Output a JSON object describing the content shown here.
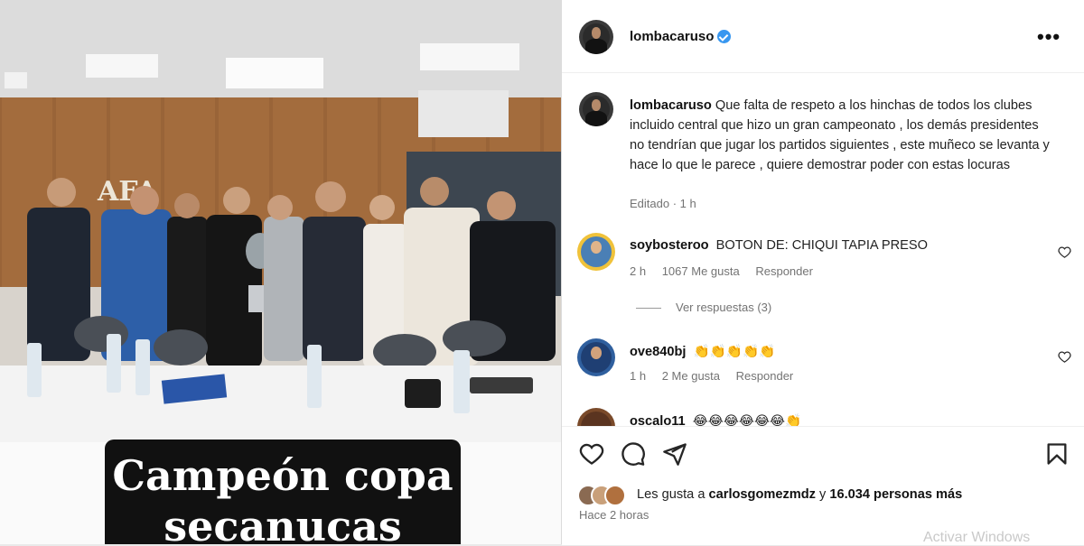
{
  "post": {
    "username": "lombacaruso",
    "caption": "Que falta de respeto a los hinchas de todos los clubes incluido central que hizo un gran campeonato , los demás presidentes no tendrían que jugar los partidos siguientes , este muñeco se levanta y hace lo que le parece , quiere demostrar poder con estas locuras",
    "caption_meta": "Editado · 1 h"
  },
  "image_caption": {
    "line1": "Campeón copa",
    "line2": "secanucas"
  },
  "comments": [
    {
      "username": "soybosteroo",
      "text": "BOTON DE: CHIQUI TAPIA PRESO",
      "time": "2 h",
      "likes": "1067 Me gusta",
      "reply": "Responder",
      "view_replies": "Ver respuestas (3)"
    },
    {
      "username": "ove840bj",
      "text": "👏👏👏👏👏",
      "time": "1 h",
      "likes": "2 Me gusta",
      "reply": "Responder"
    },
    {
      "username": "oscalo11",
      "text": "😂😂😂😂😂😂👏"
    }
  ],
  "likes": {
    "prefix": "Les gusta a",
    "user": "carlosgomezmdz",
    "middle": "y",
    "count": "16.034 personas más"
  },
  "posted_ago": "Hace 2 horas",
  "more_label": "•••",
  "watermark": "Activar Windows",
  "icons": [
    "verified-badge-icon",
    "more-options-icon",
    "heart-icon",
    "comment-icon",
    "share-icon",
    "bookmark-icon"
  ],
  "colors": {
    "verified": "#3897f0",
    "meta_text": "#737373",
    "caption_bg": "#111111"
  }
}
